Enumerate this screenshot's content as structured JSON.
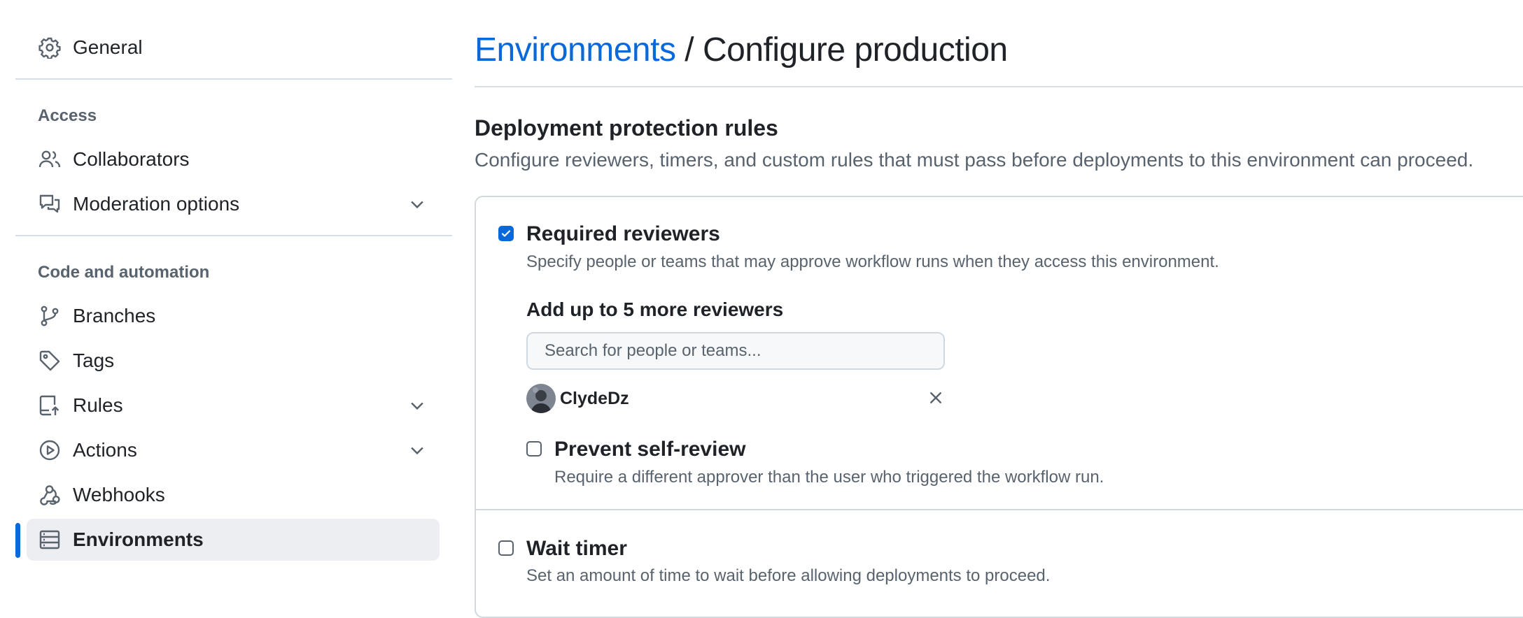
{
  "sidebar": {
    "general": {
      "label": "General",
      "icon": "gear-icon"
    },
    "sections": [
      {
        "heading": "Access"
      },
      {
        "heading": "Code and automation"
      }
    ],
    "access_items": [
      {
        "label": "Collaborators",
        "icon": "people-icon"
      },
      {
        "label": "Moderation options",
        "icon": "comment-discussion-icon",
        "expandable": true
      }
    ],
    "code_items": [
      {
        "label": "Branches",
        "icon": "git-branch-icon"
      },
      {
        "label": "Tags",
        "icon": "tag-icon"
      },
      {
        "label": "Rules",
        "icon": "repo-push-icon",
        "expandable": true
      },
      {
        "label": "Actions",
        "icon": "play-icon",
        "expandable": true
      },
      {
        "label": "Webhooks",
        "icon": "webhook-icon"
      },
      {
        "label": "Environments",
        "icon": "server-icon",
        "active": true
      }
    ]
  },
  "header": {
    "breadcrumb_link": "Environments",
    "separator": " / ",
    "title": "Configure production"
  },
  "protection": {
    "title": "Deployment protection rules",
    "description": "Configure reviewers, timers, and custom rules that must pass before deployments to this environment can proceed.",
    "required_reviewers": {
      "checked": true,
      "label": "Required reviewers",
      "description": "Specify people or teams that may approve workflow runs when they access this environment.",
      "add_label": "Add up to 5 more reviewers",
      "search_placeholder": "Search for people or teams...",
      "reviewers": [
        {
          "name": "ClydeDz"
        }
      ],
      "prevent_self_review": {
        "checked": false,
        "label": "Prevent self-review",
        "description": "Require a different approver than the user who triggered the workflow run."
      }
    },
    "wait_timer": {
      "checked": false,
      "label": "Wait timer",
      "description": "Set an amount of time to wait before allowing deployments to proceed."
    }
  },
  "colors": {
    "accent": "#0969da",
    "muted": "#59636e",
    "border": "#d1d9e0",
    "active_bg": "#eceef1"
  }
}
